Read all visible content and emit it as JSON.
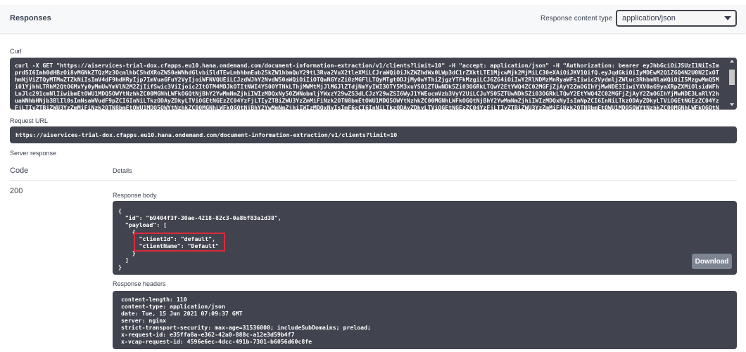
{
  "responses": {
    "title": "Responses",
    "content_type_label": "Response content type",
    "content_type_value": "application/json"
  },
  "curl": {
    "label": "Curl",
    "text": "curl -X GET \"https://aiservices-trial-dox.cfapps.eu10.hana.ondemand.com/document-information-extraction/v1/clients?limit=10\" -H \"accept: application/json\" -H \"Authorization: bearer eyJhbGciOiJSUzI1NiIsImprdSI6Imh0dHBzOi8vMGNkZTQzMz3OcmlhbC5hdXRoZWS0aWNhdGlvbi5ldTEwLmhhbmEub25kZW1hbmQuY29tL3Rva2VuX2tleXMiLCJraWQiOiJkZWZhdWx0LWp3dC1rZXktLTE1MjcwMjk2MjMiLC30eXAiOiJKV1QifQ.eyJqdGkiOiIyMDEwM2Q1ZGQ4N2U0N2IxOThmNjViZTQyMTMwZTZkNiIsImV4dF9hdHRyIjp7ImVuaGFuY2VyIjoiWFNVQUEiLCJzdWJhY2NvdW50aWQiOiIiOTQwNGYzZi0zMGFlLTQyMTgtODJjMy0wYThiZjgzYTFkMzgiLCJ6ZG4iOiIwY2RlNDMzMnRyaWFsIiwic2VydmljZWluc3RhbmNlaWQiOiI5MzgwMmQ5Mi01YjhhLTRhM2QtOGMxYy0yMmUwYmVlN2M2ZjIifSwic3ViIjoic2ItOTM4MDJkOTItNWI4YS00YTNkLThjMWMtMjJlMGJlZTdjNmYyIWI3OTY5M3xuYS01ZTUwNDk5Zi03OGRkLTQwY2EtYWQ4ZC02MGFjZjAyY2ZmOGIhYjMwNDE3IiwiYXV0aG9yaXRpZXMiOlsidWFhLnJlc291cmNlIiwibmEtOWU1MDQ5OWYtNzhkZC00MGNhLWFkOGQtNjBhY2YwMmNmZjhiIWIzMDQxNy50ZWNobmljYWxzY29wZS3dLCJzY29wZSI6WyJ1YWEucmVzb3VyY2UiLCJuYS05ZTUwNDk5Zi03OGRkLTQwY2EtYWQ4ZC02MGFjZjAyY2ZmOGIhYjMwNDE3LnRlY2huaWNhbHNjb3BlIl0sImNsaWVudF9pZCI6InNiLTkzODAyZDkyLTViOGEtNGEzZC04YzFjLTIyZTBiZWU3YzZmMiFiNzk2OTN8bmEtOWU1MDQ5OWYtNzhkZC00MGNhLWFkOGQtNjBhY2YwMmNmZjhiIWIzMDQxNyIsImNpZCI6InNiLTkzODAyZDkyLTViOGEtNGEzZC04YzFjLTIyZTBiZWU3YzZmMiFiNzk2OTN8bmEtOWU1MDQ5OWYtNzhkZC00MGNhLWFkOGQtNjBhY2YwMmNmZjhiIWIzMDQxNyIsImF6cCI6InNiLTkzODAyZDkyLTViOGEtNGEzZC04YzFjLTIyZTBiZWU3YzZmMiFiNzk2OTN8bmEtOWU1MDQ5OWYtNzhkZC00MGNhLWFkOGQtNjBhY2YwMmNmZjhiIWIzMDQxNyIsImdyYW50X3R5cGUiOiJjbGllbnRfY3JlZGVudGlhbHMiLCJyZXZfc2lnIjoiM2I1NzQ1NzYiLCJpYXQiOjE2MjM3NDA1NjcsImV4cCI6MTYyMzc4Mzc2NywiaXNzIjoiaHR0cHM6Ly8wY2RlNDMzMnRyaWFsLmF1dGhlbnRpY2F0aW9uLmV1MTAuaGFuYS5vbmRlbWFuZC5jb20vb2F1dGgvdG9rZW4iLCJ6aWQiOiIiOTQwNGYzZi0zMGFlLTQyMTgtODJjMy0wYThiZjgzYTFkMzgiLCJhdWQiOlsidWFhIiwibmEtOWU1MDQ5OWYtNzhkZC00MGNhLWFkOGQtNjBhY2YwMmNmZjhiIWIzMDQxNyJdfQ"
  },
  "request_url": {
    "label": "Request URL",
    "value": "https://aiservices-trial-dox.cfapps.eu10.hana.ondemand.com/document-information-extraction/v1/clients?limit=10"
  },
  "server_response": {
    "label": "Server response",
    "code_header": "Code",
    "details_header": "Details",
    "code": "200"
  },
  "response_body": {
    "label": "Response body",
    "lines": [
      "{",
      "  \"id\": \"b9404f3f-30ae-4218-82c3-0a8bf83a1d38\",",
      "  \"payload\": [",
      "    {",
      "      \"clientId\": \"default\",",
      "      \"clientName\": \"Default\"",
      "    }",
      "  ]",
      "}"
    ],
    "download_label": "Download"
  },
  "response_headers": {
    "label": "Response headers",
    "lines": [
      "content-length: 110",
      "content-type: application/json",
      "date: Tue, 15 Jun 2021 07:09:37 GMT",
      "server: nginx",
      "strict-transport-security: max-age=31536000; includeSubDomains; preload;",
      "x-request-id: e35ffa8a-e362-42a0-888c-a12e3d59b4f7",
      "x-vcap-request-id: 4596e6ec-4dcc-491b-7301-b6056d60c8fe"
    ]
  }
}
